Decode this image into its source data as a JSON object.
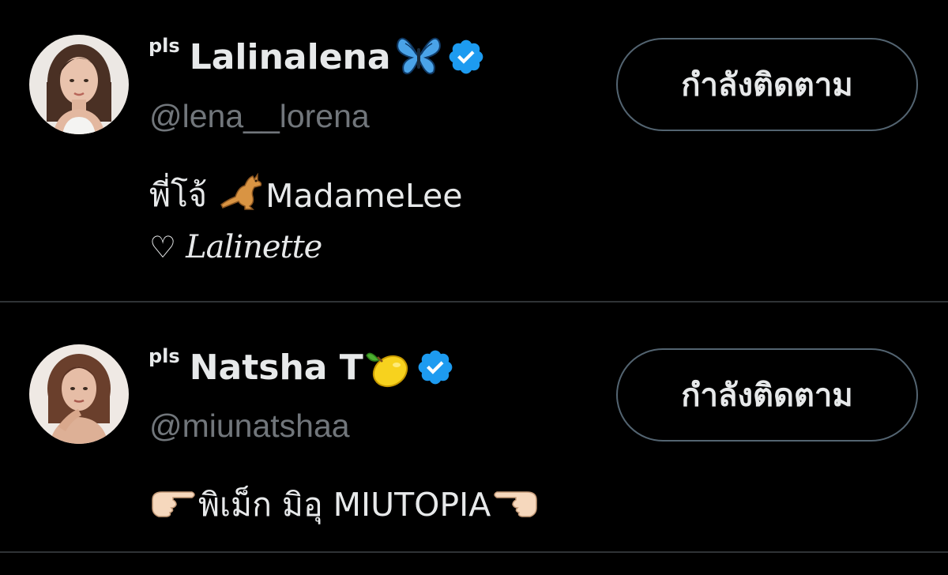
{
  "accounts": [
    {
      "affiliate_label": "pls",
      "display_name": "Lalinalena",
      "name_emoji": "butterfly-emoji",
      "verified": true,
      "verified_color": "#1d9bf0",
      "handle": "@lena__lorena",
      "bio_lines": [
        "พี่โจ้",
        "MadameLee",
        "♡",
        "Lalinette"
      ],
      "bio_emoji": "kangaroo-emoji",
      "follow_button_label": "กำลังติดตาม"
    },
    {
      "affiliate_label": "pls",
      "display_name": "Natsha T",
      "name_emoji": "lemon-emoji",
      "verified": true,
      "verified_color": "#1d9bf0",
      "handle": "@miunatshaa",
      "bio_text": "พิเม็ก มิอุ MIUTOPIA",
      "bio_emoji_left": "pointing-right-hand-emoji",
      "bio_emoji_right": "pointing-left-hand-emoji",
      "follow_button_label": "กำลังติดตาม"
    }
  ],
  "colors": {
    "background": "#000000",
    "primary_text": "#e7e9ea",
    "secondary_text": "#71767b",
    "divider": "#2f3336",
    "button_border": "#536471"
  }
}
